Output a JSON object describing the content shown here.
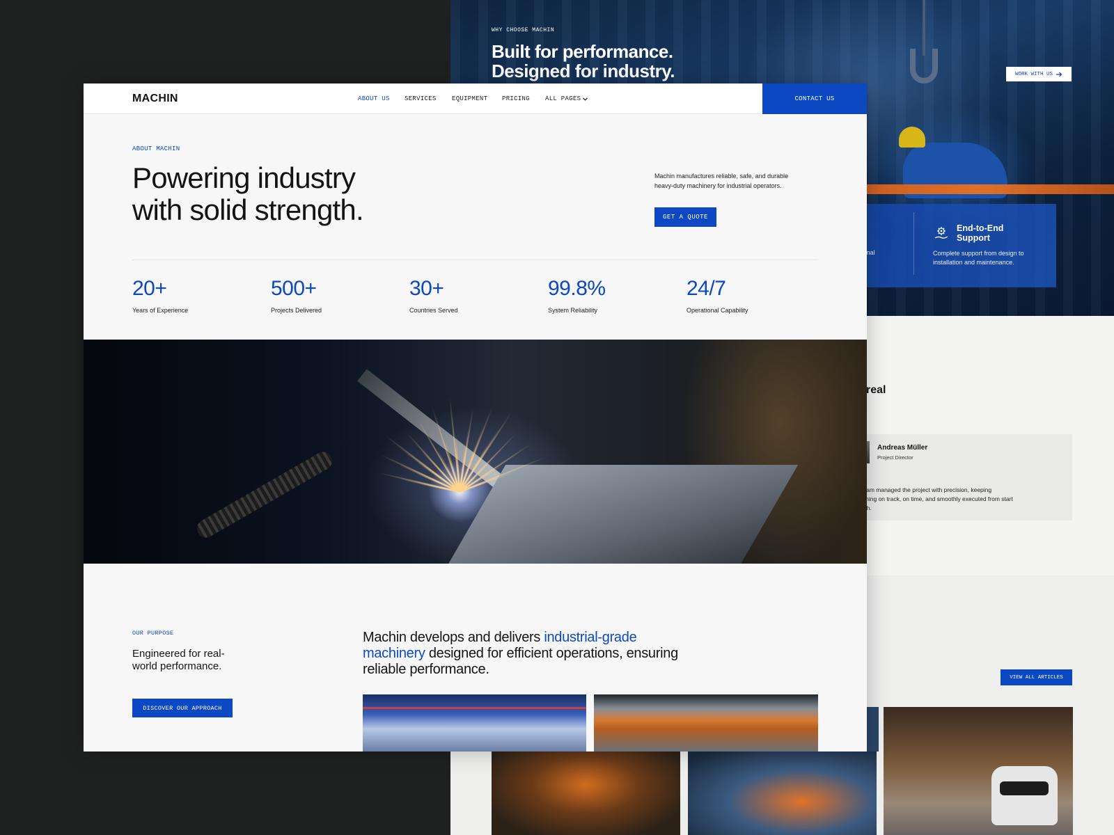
{
  "background_page": {
    "hero": {
      "eyebrow": "WHY CHOOSE MACHIN",
      "title_line1": "Built for performance.",
      "title_line2": "Designed for industry.",
      "work_button": "WORK WITH US",
      "card": {
        "left_title_fragment": "e",
        "left_text_line1": "ernational",
        "left_text_line2": "ards.",
        "title_line1": "End-to-End",
        "title_line2": "Support",
        "text": "Complete support from design to installation and maintenance."
      }
    },
    "testimonial": {
      "heading_fragment": "real",
      "author": "Andreas Müller",
      "role": "Project Director",
      "quote": "The team managed the project with precision, keeping everything on track, on time, and smoothly executed from start to finish."
    },
    "articles_button": "VIEW ALL ARTICLES"
  },
  "nav": {
    "logo": "MACHIN",
    "links": [
      "ABOUT US",
      "SERVICES",
      "EQUIPMENT",
      "PRICING",
      "ALL PAGES"
    ],
    "active": "ABOUT US",
    "contact": "CONTACT US"
  },
  "hero": {
    "eyebrow": "ABOUT MACHIN",
    "title_line1": "Powering industry",
    "title_line2": "with solid strength.",
    "description": "Machin manufactures reliable, safe, and durable heavy-duty machinery for industrial operators.",
    "cta": "GET A QUOTE"
  },
  "stats": [
    {
      "value": "20+",
      "label": "Years of Experience"
    },
    {
      "value": "500+",
      "label": "Projects Delivered"
    },
    {
      "value": "30+",
      "label": "Countries Served"
    },
    {
      "value": "99.8%",
      "label": "System Reliability"
    },
    {
      "value": "24/7",
      "label": "Operational Capability"
    }
  ],
  "purpose": {
    "eyebrow": "OUR PURPOSE",
    "title": "Engineered for real-world performance.",
    "button": "DISCOVER OUR APPROACH",
    "statement_pre": "Machin develops and delivers ",
    "statement_highlight": "industrial-grade machinery",
    "statement_post": " designed for efficient operations, ensuring reliable performance."
  },
  "colors": {
    "accent": "#0b48c2",
    "page_bg": "#f7f7f7",
    "backdrop": "#1e2120"
  },
  "icons": [
    "support-gear-hand-icon",
    "arrow-right-icon",
    "chevron-down-icon"
  ]
}
